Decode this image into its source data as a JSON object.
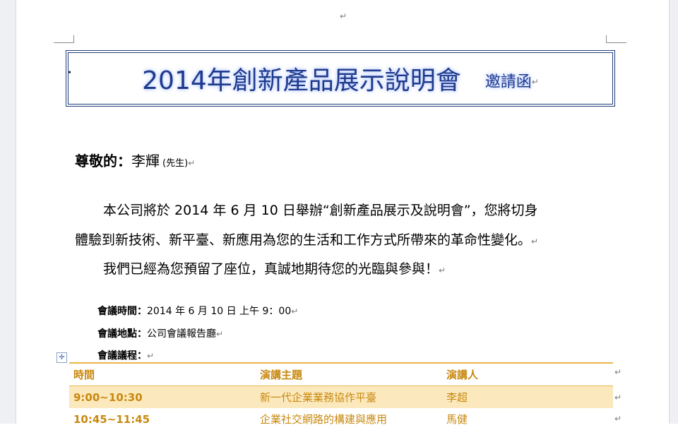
{
  "document": {
    "title": "2014年創新產品展示說明會",
    "subtitle": "邀請函",
    "salutation": {
      "label": "尊敬的：",
      "name": "李輝",
      "honorific": "(先生)"
    },
    "paragraphs": [
      "本公司將於 2014 年 6 月 10 日舉辦“創新產品展示及說明會”，您將切身",
      "體驗到新技術、新平臺、新應用為您的生活和工作方式所帶來的革命性變化。",
      "我們已經為您預留了座位，真誠地期待您的光臨與參與！"
    ],
    "info": {
      "time_label": "會議時間：",
      "time_value": "2014 年 6 月 10 日 上午 9：00",
      "place_label": "會議地點：",
      "place_value": "公司會議報告廳",
      "agenda_label": "會議議程：",
      "agenda_value": ""
    },
    "agenda_table": {
      "headers": [
        "時間",
        "演講主題",
        "演講人"
      ],
      "rows": [
        [
          "9:00~10:30",
          "新一代企業業務協作平臺",
          "李超"
        ],
        [
          "10:45~11:45",
          "企業社交網路的構建與應用",
          "馬健"
        ]
      ]
    }
  },
  "marks": {
    "paragraph": "↵",
    "table_handle": "✛"
  }
}
